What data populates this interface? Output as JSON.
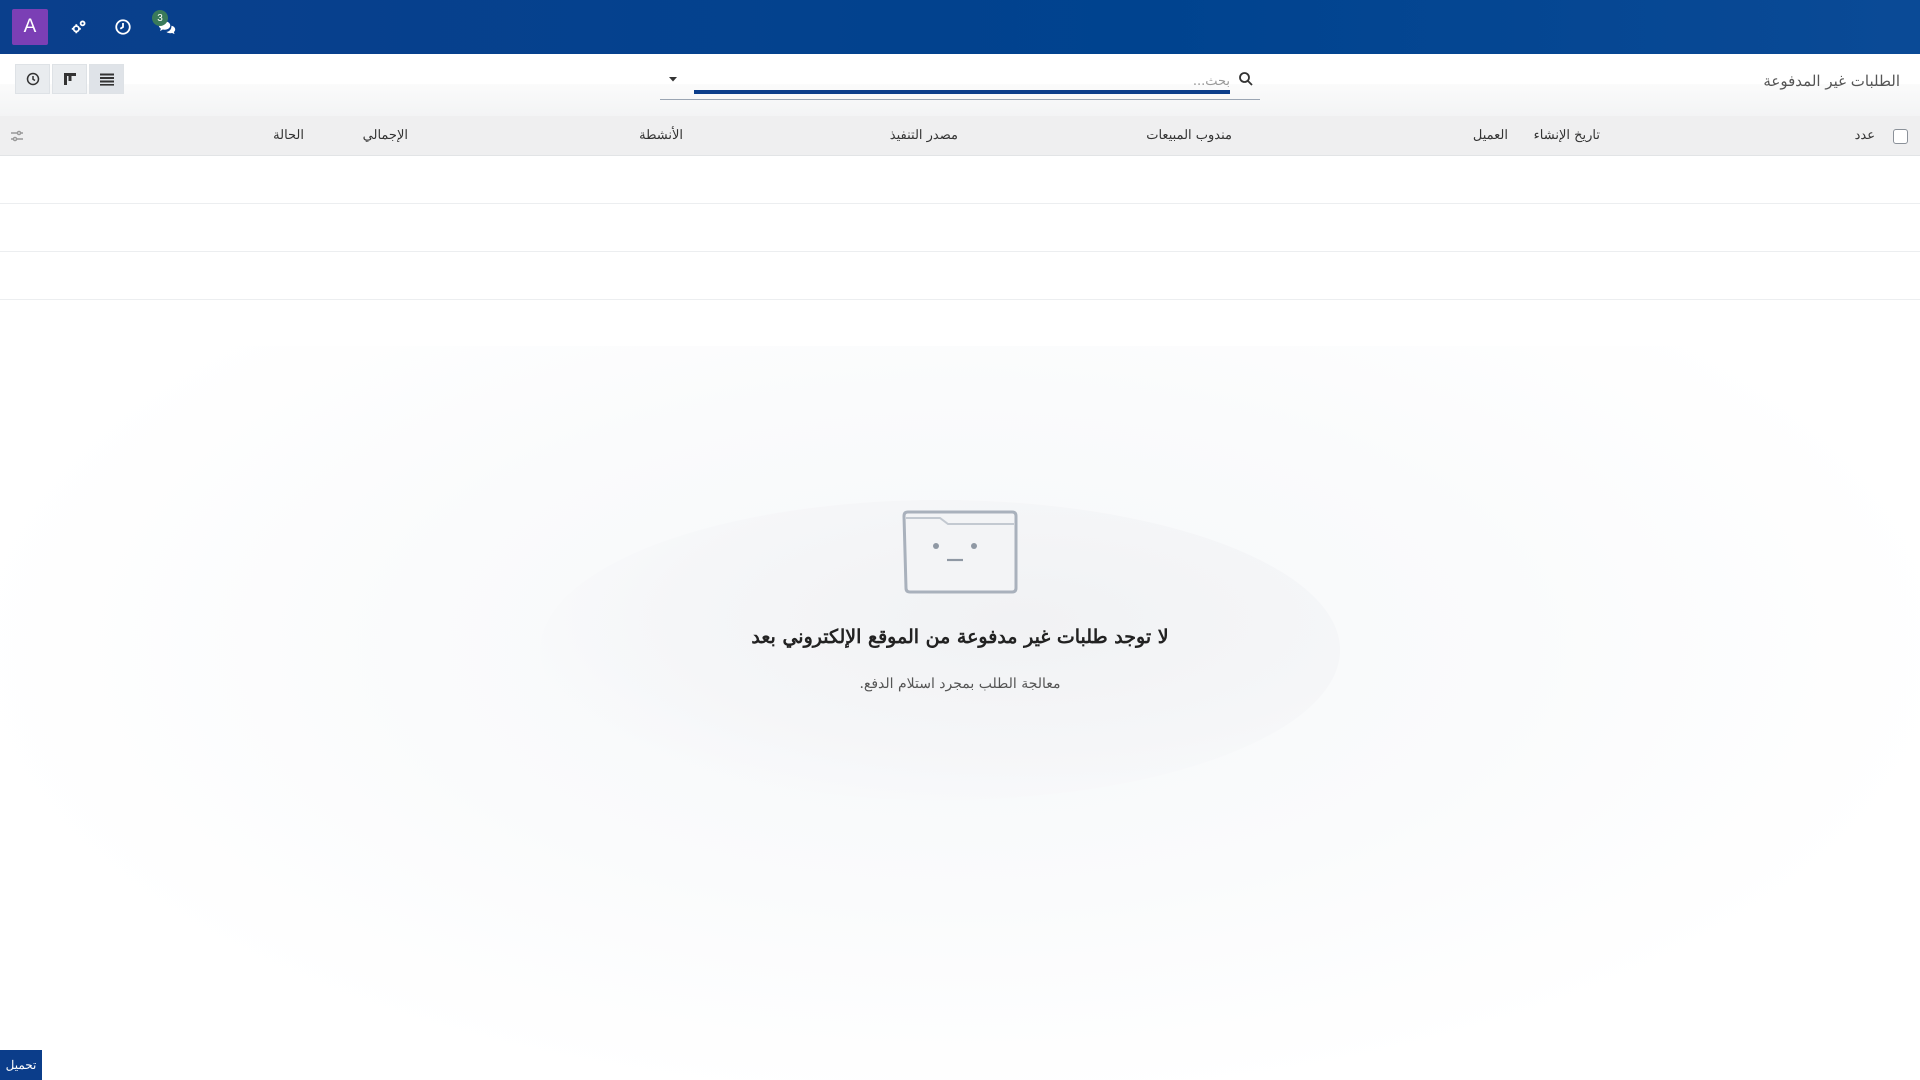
{
  "navbar": {
    "avatar_letter": "A",
    "messages_badge": "3",
    "icons": [
      "settings-icon",
      "clock-icon",
      "chat-icon"
    ]
  },
  "control_panel": {
    "title": "الطلبات غير المدفوعة",
    "search_placeholder": "بحث..."
  },
  "list": {
    "columns": {
      "number": "عدد",
      "create_date": "تاريخ الإنشاء",
      "customer": "العميل",
      "salesperson": "مندوب المبيعات",
      "source": "مصدر التنفيذ",
      "activities": "الأنشطة",
      "total": "الإجمالي",
      "status": "الحالة"
    }
  },
  "empty_state": {
    "title": "لا توجد طلبات غير مدفوعة من الموقع الإلكتروني بعد",
    "subtitle": "معالجة الطلب بمجرد استلام الدفع."
  },
  "footer": {
    "upload_label": "تحميل"
  },
  "colors": {
    "navbar": "#00438f",
    "avatar": "#7b3fb5",
    "accent": "#0b3d8a"
  }
}
